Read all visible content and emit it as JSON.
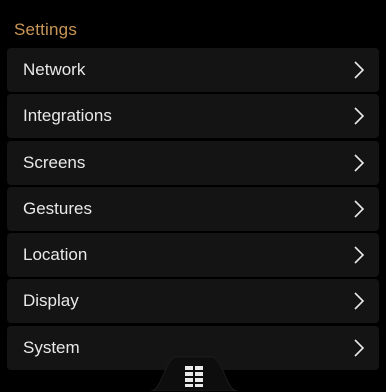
{
  "header": {
    "title": "Settings",
    "accent_color": "#c99757"
  },
  "menu": {
    "items": [
      {
        "label": "Network",
        "icon": "chevron-right-icon"
      },
      {
        "label": "Integrations",
        "icon": "chevron-right-icon"
      },
      {
        "label": "Screens",
        "icon": "chevron-right-icon"
      },
      {
        "label": "Gestures",
        "icon": "chevron-right-icon"
      },
      {
        "label": "Location",
        "icon": "chevron-right-icon"
      },
      {
        "label": "Display",
        "icon": "chevron-right-icon"
      },
      {
        "label": "System",
        "icon": "chevron-right-icon"
      }
    ]
  },
  "bottom_bar": {
    "icon": "grid-icon"
  },
  "colors": {
    "background": "#000000",
    "row_background": "#141414",
    "text": "#e9e9e9"
  }
}
